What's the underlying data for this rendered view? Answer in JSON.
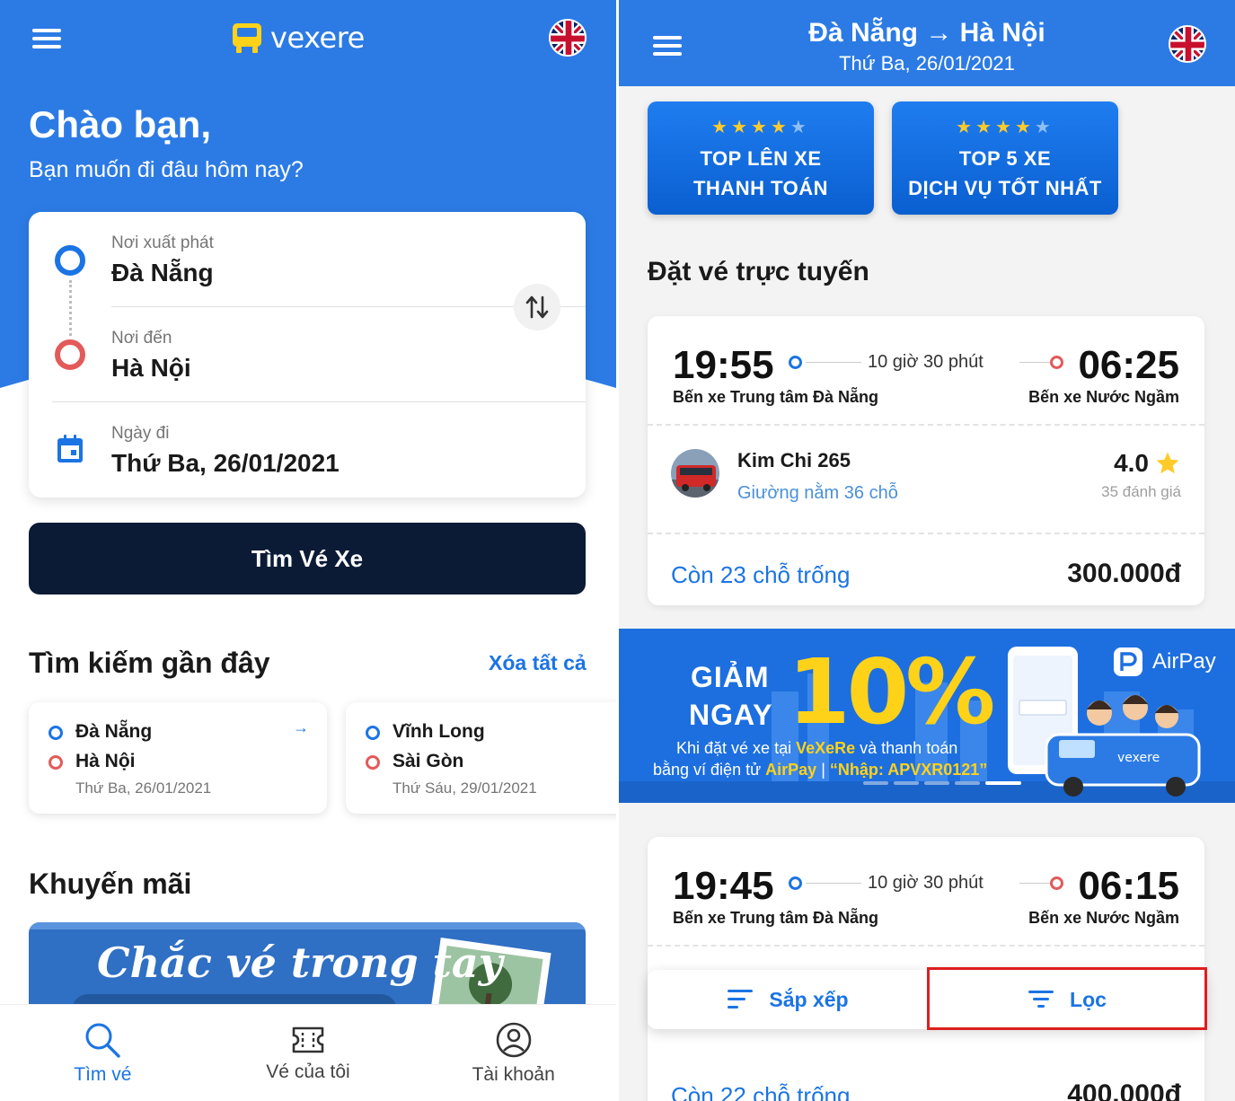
{
  "colors": {
    "brand_blue": "#2c7be5",
    "header_blue": "#1f72ea",
    "accent_blue": "#1b74e4",
    "dark_button": "#0b1b36",
    "origin_ring": "#1b74e4",
    "destination_ring": "#e35a5a",
    "star_yellow": "#ffcb2b",
    "highlight_red": "#dd1f1f"
  },
  "home": {
    "header": {
      "menu_icon": "hamburger-menu-icon",
      "logo_text": "vexere",
      "language_icon": "uk-flag-icon"
    },
    "greeting": {
      "title": "Chào bạn,",
      "subtitle": "Bạn muốn đi đâu hôm nay?"
    },
    "search_form": {
      "origin_label": "Nơi xuất phát",
      "origin_value": "Đà Nẵng",
      "destination_label": "Nơi đến",
      "destination_value": "Hà Nội",
      "date_label": "Ngày đi",
      "date_value": "Thứ Ba, 26/01/2021",
      "swap_icon": "swap-vertical-icon",
      "calendar_icon": "calendar-icon"
    },
    "search_button": "Tìm Vé Xe",
    "recent": {
      "title": "Tìm kiếm gần đây",
      "clear_all": "Xóa tất cả",
      "items": [
        {
          "from": "Đà Nẵng",
          "to": "Hà Nội",
          "date": "Thứ Ba, 26/01/2021"
        },
        {
          "from": "Vĩnh Long",
          "to": "Sài Gòn",
          "date": "Thứ Sáu, 29/01/2021"
        }
      ]
    },
    "promotions": {
      "title": "Khuyến mãi",
      "banner_text": "Chắc vé trong tay"
    },
    "bottom_nav": [
      {
        "label": "Tìm vé",
        "icon": "search-icon",
        "active": true
      },
      {
        "label": "Vé của tôi",
        "icon": "ticket-icon",
        "active": false
      },
      {
        "label": "Tài khoản",
        "icon": "account-icon",
        "active": false
      }
    ]
  },
  "results": {
    "header": {
      "from": "Đà Nẵng",
      "arrow": "→",
      "to": "Hà Nội",
      "date": "Thứ Ba, 26/01/2021"
    },
    "badges": [
      {
        "line1": "TOP LÊN XE",
        "line2": "THANH TOÁN",
        "stars_on": 4,
        "stars_total": 5
      },
      {
        "line1": "TOP 5 XE",
        "line2": "DỊCH VỤ TỐT NHẤT",
        "stars_on": 4,
        "stars_total": 5
      }
    ],
    "section_title": "Đặt vé trực tuyến",
    "trips": [
      {
        "depart_time": "19:55",
        "arrive_time": "06:25",
        "duration": "10 giờ 30 phút",
        "depart_station": "Bến xe Trung tâm Đà Nẵng",
        "arrive_station": "Bến xe Nước Ngầm",
        "operator": "Kim Chi 265",
        "bus_type": "Giường nằm 36 chỗ",
        "rating": "4.0",
        "reviews": "35 đánh giá",
        "seats_left": "Còn 23 chỗ trống",
        "price": "300.000đ"
      },
      {
        "depart_time": "19:45",
        "arrive_time": "06:15",
        "duration": "10 giờ 30 phút",
        "depart_station": "Bến xe Trung tâm Đà Nẵng",
        "arrive_station": "Bến xe Nước Ngầm",
        "seats_left": "Còn 22 chỗ trống",
        "price": "400.000đ"
      }
    ],
    "promo_banner": {
      "word1": "GIẢM",
      "word2": "NGAY",
      "percent": "10%",
      "line1_pre": "Khi đặt vé xe tại ",
      "line1_brand": "VeXeRe",
      "line1_post": " và thanh toán",
      "line2_pre": "bằng ví điện tử ",
      "line2_brand": "AirPay",
      "line2_sep": " | ",
      "line2_code": "“Nhập: APVXR0121”",
      "partner": "AirPay",
      "bus_logo": "vexere",
      "slides_total": 5,
      "slide_active": 5
    },
    "sort_bar": {
      "sort_label": "Sắp xếp",
      "filter_label": "Lọc",
      "sort_icon": "sort-icon",
      "filter_icon": "filter-icon"
    }
  }
}
